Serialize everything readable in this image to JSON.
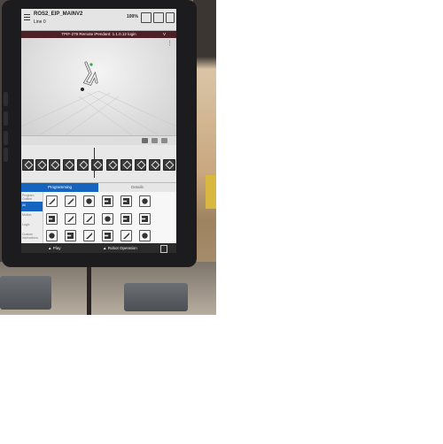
{
  "photo_scene": {
    "description_free": true
  },
  "topbar": {
    "program_title": "ROS2_EIP_MAINV2",
    "program_line": "Line 0",
    "battery_pct": "100%",
    "menu_icon": "hamburger-icon",
    "status_icons": [
      "keyboard-icon",
      "robot-status-icon",
      "tablet-icon"
    ]
  },
  "remote_bar": {
    "text": "TPIF-279  Remote iPendant: 1.1.0.12 login",
    "chevron": "V",
    "chevron_icon": "chevron-down-icon"
  },
  "viewport": {
    "robot_icon": "robot-arm-icon",
    "overflow_icon": "more-icon"
  },
  "mini_toolbar": {
    "icons": [
      "view-icon",
      "camera-icon",
      "grid-icon"
    ]
  },
  "timeline": {
    "icon_count": 10,
    "icon_names": [
      "instruction-icon"
    ]
  },
  "tabs": {
    "active": "Programming",
    "inactive": "Details"
  },
  "palette": {
    "categories": [
      "Program Outline",
      "All",
      "Motion",
      "Logic",
      "Custom Instructions"
    ],
    "icon_names": [
      "move-icon",
      "move-linear-icon",
      "arc-icon",
      "grid-icon",
      "table-icon",
      "gripper-icon"
    ]
  },
  "bottom_bar": {
    "play_label": "Play",
    "robot_label": "Robot Operation",
    "play_icon": "play-icon",
    "save_icon": "save-icon"
  },
  "colors": {
    "remote_bar_bg": "#4d2026",
    "tab_active_bg": "#1565c0",
    "tablet_frame": "#1c1c1e"
  }
}
